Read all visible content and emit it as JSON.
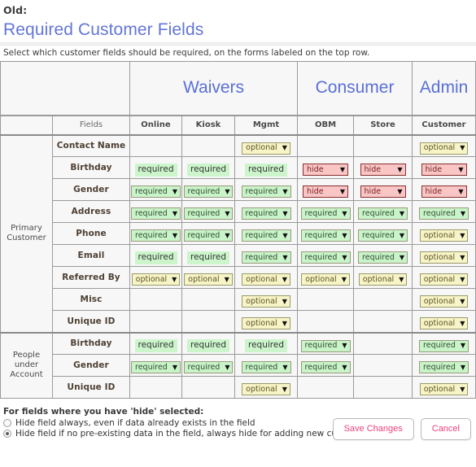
{
  "old_label": "Old:",
  "page_title": "Required Customer Fields",
  "subtitle": "Select which customer fields should be required, on the forms labeled on the top row.",
  "header": {
    "groups": [
      {
        "label": "",
        "span": 2
      },
      {
        "label": "Waivers",
        "span": 3
      },
      {
        "label": "Consumer",
        "span": 2
      },
      {
        "label": "Admin",
        "span": 1
      }
    ],
    "columns": [
      "Fields",
      "Online",
      "Kiosk",
      "Mgmt",
      "OBM",
      "Store",
      "Customer"
    ]
  },
  "sections": [
    {
      "group_label": "Primary Customer",
      "rows": [
        {
          "field": "Contact Name",
          "cells": [
            {
              "kind": "empty"
            },
            {
              "kind": "empty"
            },
            {
              "kind": "select",
              "value": "optional"
            },
            {
              "kind": "empty"
            },
            {
              "kind": "empty"
            },
            {
              "kind": "select",
              "value": "optional"
            }
          ]
        },
        {
          "field": "Birthday",
          "cells": [
            {
              "kind": "text",
              "value": "required"
            },
            {
              "kind": "text",
              "value": "required"
            },
            {
              "kind": "text",
              "value": "required"
            },
            {
              "kind": "select",
              "value": "hide"
            },
            {
              "kind": "select",
              "value": "hide"
            },
            {
              "kind": "select",
              "value": "hide"
            }
          ]
        },
        {
          "field": "Gender",
          "cells": [
            {
              "kind": "select",
              "value": "required"
            },
            {
              "kind": "select",
              "value": "required"
            },
            {
              "kind": "select",
              "value": "required"
            },
            {
              "kind": "select",
              "value": "hide"
            },
            {
              "kind": "select",
              "value": "hide"
            },
            {
              "kind": "select",
              "value": "hide"
            }
          ]
        },
        {
          "field": "Address",
          "cells": [
            {
              "kind": "select",
              "value": "required"
            },
            {
              "kind": "select",
              "value": "required"
            },
            {
              "kind": "select",
              "value": "required"
            },
            {
              "kind": "select",
              "value": "required"
            },
            {
              "kind": "select",
              "value": "required"
            },
            {
              "kind": "select",
              "value": "required"
            }
          ]
        },
        {
          "field": "Phone",
          "cells": [
            {
              "kind": "select",
              "value": "required"
            },
            {
              "kind": "select",
              "value": "required"
            },
            {
              "kind": "select",
              "value": "required"
            },
            {
              "kind": "select",
              "value": "required"
            },
            {
              "kind": "select",
              "value": "required"
            },
            {
              "kind": "select",
              "value": "optional"
            }
          ]
        },
        {
          "field": "Email",
          "cells": [
            {
              "kind": "text",
              "value": "required"
            },
            {
              "kind": "text",
              "value": "required"
            },
            {
              "kind": "select",
              "value": "required"
            },
            {
              "kind": "select",
              "value": "required"
            },
            {
              "kind": "select",
              "value": "required"
            },
            {
              "kind": "select",
              "value": "optional"
            }
          ]
        },
        {
          "field": "Referred By",
          "cells": [
            {
              "kind": "select",
              "value": "optional"
            },
            {
              "kind": "select",
              "value": "optional"
            },
            {
              "kind": "select",
              "value": "optional"
            },
            {
              "kind": "select",
              "value": "optional"
            },
            {
              "kind": "select",
              "value": "optional"
            },
            {
              "kind": "select",
              "value": "optional"
            }
          ]
        },
        {
          "field": "Misc",
          "cells": [
            {
              "kind": "empty"
            },
            {
              "kind": "empty"
            },
            {
              "kind": "select",
              "value": "optional"
            },
            {
              "kind": "empty"
            },
            {
              "kind": "empty"
            },
            {
              "kind": "select",
              "value": "optional"
            }
          ]
        },
        {
          "field": "Unique ID",
          "cells": [
            {
              "kind": "empty"
            },
            {
              "kind": "empty"
            },
            {
              "kind": "select",
              "value": "optional"
            },
            {
              "kind": "empty"
            },
            {
              "kind": "empty"
            },
            {
              "kind": "select",
              "value": "optional"
            }
          ]
        }
      ]
    },
    {
      "group_label": "People under Account",
      "rows": [
        {
          "field": "Birthday",
          "cells": [
            {
              "kind": "text",
              "value": "required"
            },
            {
              "kind": "text",
              "value": "required"
            },
            {
              "kind": "text",
              "value": "required"
            },
            {
              "kind": "select",
              "value": "required"
            },
            {
              "kind": "empty"
            },
            {
              "kind": "select",
              "value": "required"
            }
          ]
        },
        {
          "field": "Gender",
          "cells": [
            {
              "kind": "select",
              "value": "required"
            },
            {
              "kind": "select",
              "value": "required"
            },
            {
              "kind": "select",
              "value": "required"
            },
            {
              "kind": "select",
              "value": "required"
            },
            {
              "kind": "empty"
            },
            {
              "kind": "select",
              "value": "required"
            }
          ]
        },
        {
          "field": "Unique ID",
          "cells": [
            {
              "kind": "empty"
            },
            {
              "kind": "empty"
            },
            {
              "kind": "select",
              "value": "optional"
            },
            {
              "kind": "empty"
            },
            {
              "kind": "empty"
            },
            {
              "kind": "select",
              "value": "optional"
            }
          ]
        }
      ]
    }
  ],
  "footer": {
    "title": "For fields where you have 'hide' selected:",
    "options": [
      {
        "label": "Hide field always, even if data already exists in the field",
        "checked": false
      },
      {
        "label": "Hide field if no pre-existing data in the field, always hide for adding new customers",
        "checked": true
      }
    ],
    "save_label": "Save Changes",
    "cancel_label": "Cancel"
  },
  "colors": {
    "title_blue": "#6376d6",
    "required_green": "#c9f3c9",
    "optional_yellow": "#f7f4c8",
    "hide_pink": "#f9c5c5",
    "button_pink": "#f0407f"
  },
  "icons": {
    "dropdown_arrow": "chevron-down-icon"
  }
}
